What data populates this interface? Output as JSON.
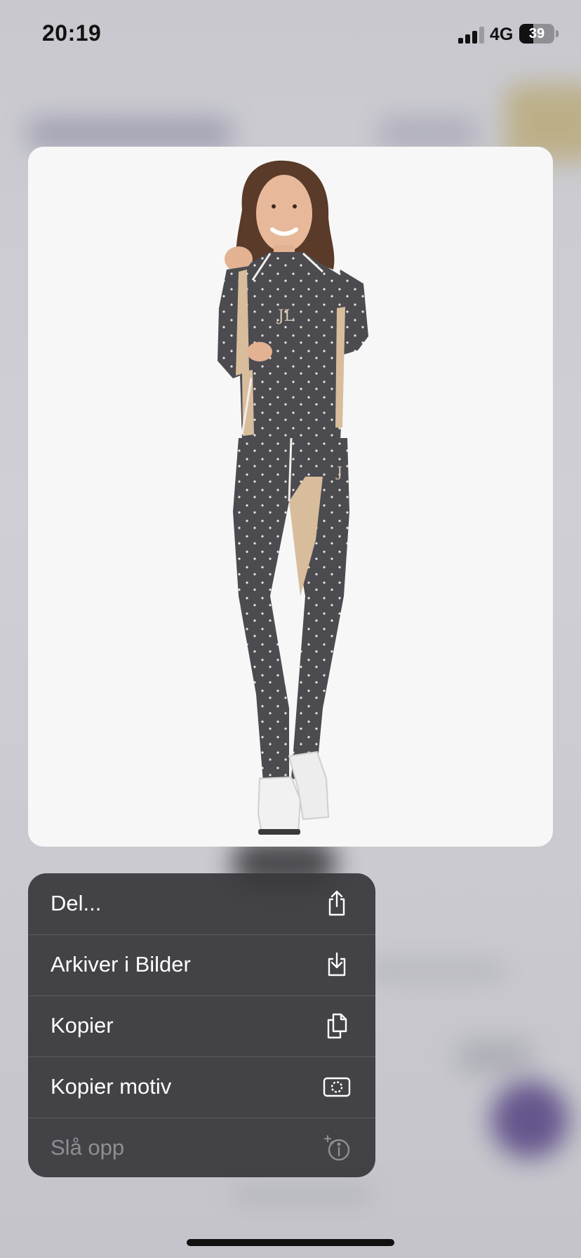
{
  "status_bar": {
    "time": "20:19",
    "network": "4G",
    "battery_level": "39",
    "battery_fraction": 0.39
  },
  "preview": {
    "icon": "product-photo-woman-base-layer"
  },
  "menu": {
    "items": [
      {
        "label": "Del...",
        "icon": "share-icon",
        "enabled": true
      },
      {
        "label": "Arkiver i Bilder",
        "icon": "save-to-photos-icon",
        "enabled": true
      },
      {
        "label": "Kopier",
        "icon": "copy-icon",
        "enabled": true
      },
      {
        "label": "Kopier motiv",
        "icon": "copy-subject-icon",
        "enabled": true
      },
      {
        "label": "Slå opp",
        "icon": "look-up-icon",
        "enabled": false
      }
    ]
  },
  "colors": {
    "menu_background": "#38383c",
    "menu_text": "#ffffff",
    "menu_text_disabled": "#8e8e93",
    "card_background": "#f7f7f7",
    "garment": "#4a4a4f",
    "garment_accent": "#d8bd9c"
  }
}
